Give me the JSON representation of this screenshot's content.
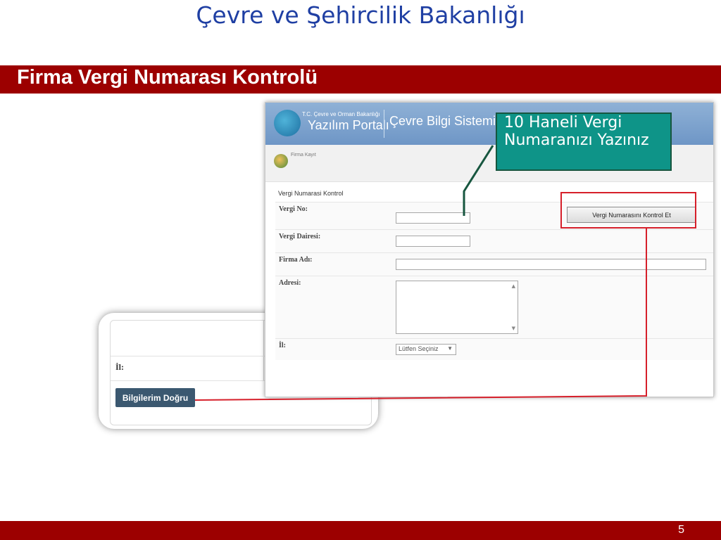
{
  "slide": {
    "title": "Çevre ve Şehircilik Bakanlığı",
    "subtitle": "Firma Vergi Numarası Kontrolü",
    "page_number": "5"
  },
  "portal": {
    "logo_small": "T.C. Çevre ve Orman Bakanlığı",
    "logo_big": "Yazılım Portalı",
    "system_name": "Çevre Bilgi Sistemi",
    "breadcrumb": "Firma Kayıt"
  },
  "form": {
    "section_title": "Vergi Numarasi Kontrol",
    "fields": {
      "vergi_no": "Vergi No:",
      "vergi_dairesi": "Vergi Dairesi:",
      "firma_adi": "Firma Adı:",
      "adresi": "Adresi:",
      "il": "İl:"
    },
    "check_button": "Vergi Numarasını Kontrol Et",
    "select_value": "Lütfen Seçiniz"
  },
  "back_screen": {
    "il_label": "İl:",
    "confirm_button": "Bilgilerim Doğru"
  },
  "annotation": {
    "callout_text": "10 Haneli Vergi Numaranızı Yazınız"
  },
  "colors": {
    "brand_red": "#9c0000",
    "title_blue": "#1f3fa3",
    "callout_teal": "#0e9488",
    "highlight_red": "#d61f2a"
  }
}
